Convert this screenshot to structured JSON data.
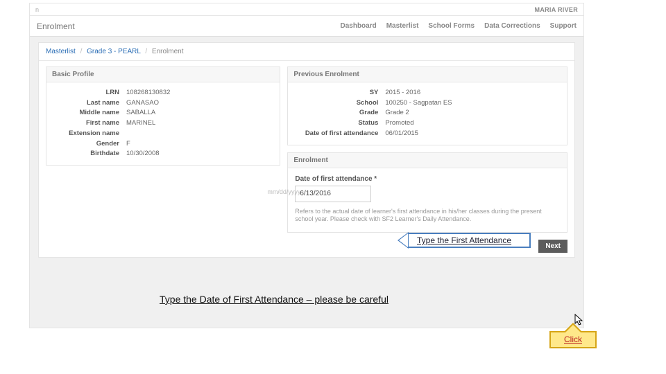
{
  "topbar": {
    "left_cutoff": "n",
    "user_name": "MARIA RIVER"
  },
  "nav": {
    "page_title": "Enrolment",
    "tabs": [
      "Dashboard",
      "Masterlist",
      "School Forms",
      "Data Corrections",
      "Support"
    ]
  },
  "breadcrumb": {
    "a": "Masterlist",
    "b": "Grade 3 - PEARL",
    "c": "Enrolment"
  },
  "basic_profile": {
    "heading": "Basic Profile",
    "labels": {
      "lrn": "LRN",
      "last": "Last name",
      "middle": "Middle name",
      "first": "First name",
      "ext": "Extension name",
      "gender": "Gender",
      "birth": "Birthdate"
    },
    "values": {
      "lrn": "108268130832",
      "last": "GANASAO",
      "middle": "SABALLA",
      "first": "MARINEL",
      "ext": "",
      "gender": "F",
      "birth": "10/30/2008"
    }
  },
  "previous_enrolment": {
    "heading": "Previous Enrolment",
    "labels": {
      "sy": "SY",
      "school": "School",
      "grade": "Grade",
      "status": "Status",
      "dfa": "Date of first attendance"
    },
    "values": {
      "sy": "2015 - 2016",
      "school": "100250 - Sagpatan ES",
      "grade": "Grade 2",
      "status": "Promoted",
      "dfa": "06/01/2015"
    }
  },
  "enrolment_form": {
    "heading": "Enrolment",
    "field_label": "Date of first attendance *",
    "ghost_placeholder": "mm/dd/yyyy",
    "value": "6/13/2016",
    "helper": "Refers to the actual date of learner's first attendance in his/her classes during the present school year. Please check with SF2 Learner's Daily Attendance."
  },
  "footer": {
    "next": "Next"
  },
  "annotations": {
    "blue_callout": "Type the First Attendance",
    "instruction_line": "Type the Date of First Attendance – please be careful",
    "yellow_callout": "Click"
  }
}
